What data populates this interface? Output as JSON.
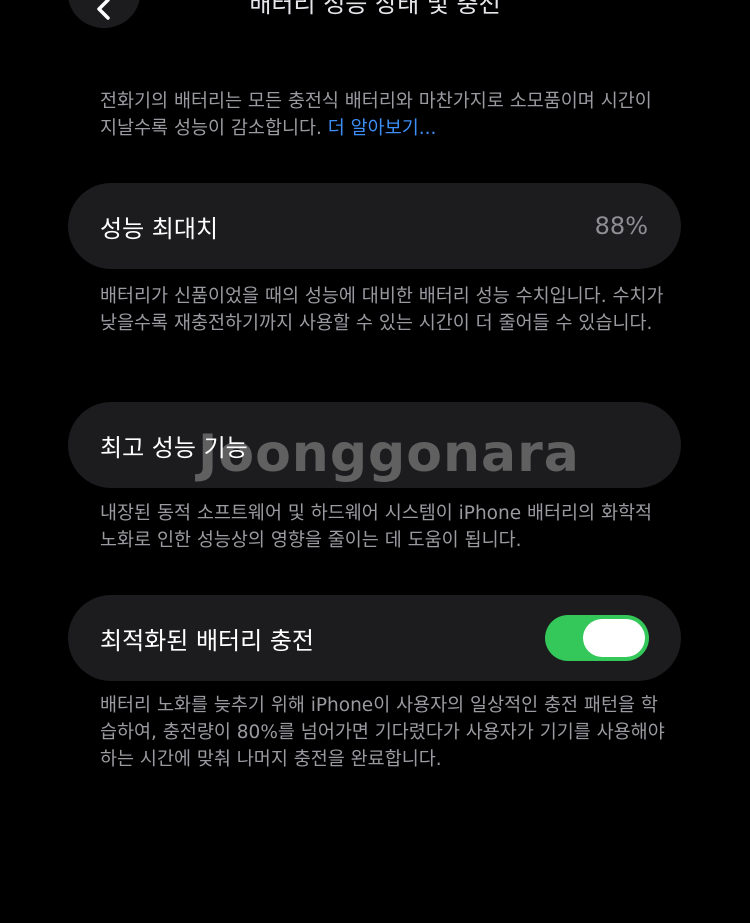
{
  "nav": {
    "title": "배터리 성능 상태 및 충전",
    "back_icon": "chevron-left-icon"
  },
  "intro": {
    "text": "전화기의 배터리는 모든 충전식 배터리와 마찬가지로 소모품이며 시간이 지날수록 성능이 감소합니다. ",
    "link": "더 알아보기..."
  },
  "max_capacity": {
    "label": "성능 최대치",
    "value": "88%",
    "description": "배터리가 신품이었을 때의 성능에 대비한 배터리 성능 수치입니다. 수치가 낮을수록 재충전하기까지 사용할 수 있는 시간이 더 줄어들 수 있습니다."
  },
  "peak_performance": {
    "label": "최고 성능 기능",
    "description": "내장된 동적 소프트웨어 및 하드웨어 시스템이 iPhone 배터리의 화학적 노화로 인한 성능상의 영향을 줄이는 데 도움이 됩니다."
  },
  "optimized_charging": {
    "label": "최적화된 배터리 충전",
    "enabled": true,
    "toggle_color": "#34c759",
    "description": "배터리 노화를 늦추기 위해 iPhone이 사용자의 일상적인 충전 패턴을 학습하여, 충전량이 80%를 넘어가면 기다렸다가 사용자가 기기를 사용해야 하는 시간에 맞춰 나머지 충전을 완료합니다."
  },
  "watermark": {
    "text": "Joonggonara"
  },
  "colors": {
    "background": "#000000",
    "card": "#1c1c1e",
    "link": "#3d8ef7",
    "secondary_text": "#9a9aa0"
  }
}
